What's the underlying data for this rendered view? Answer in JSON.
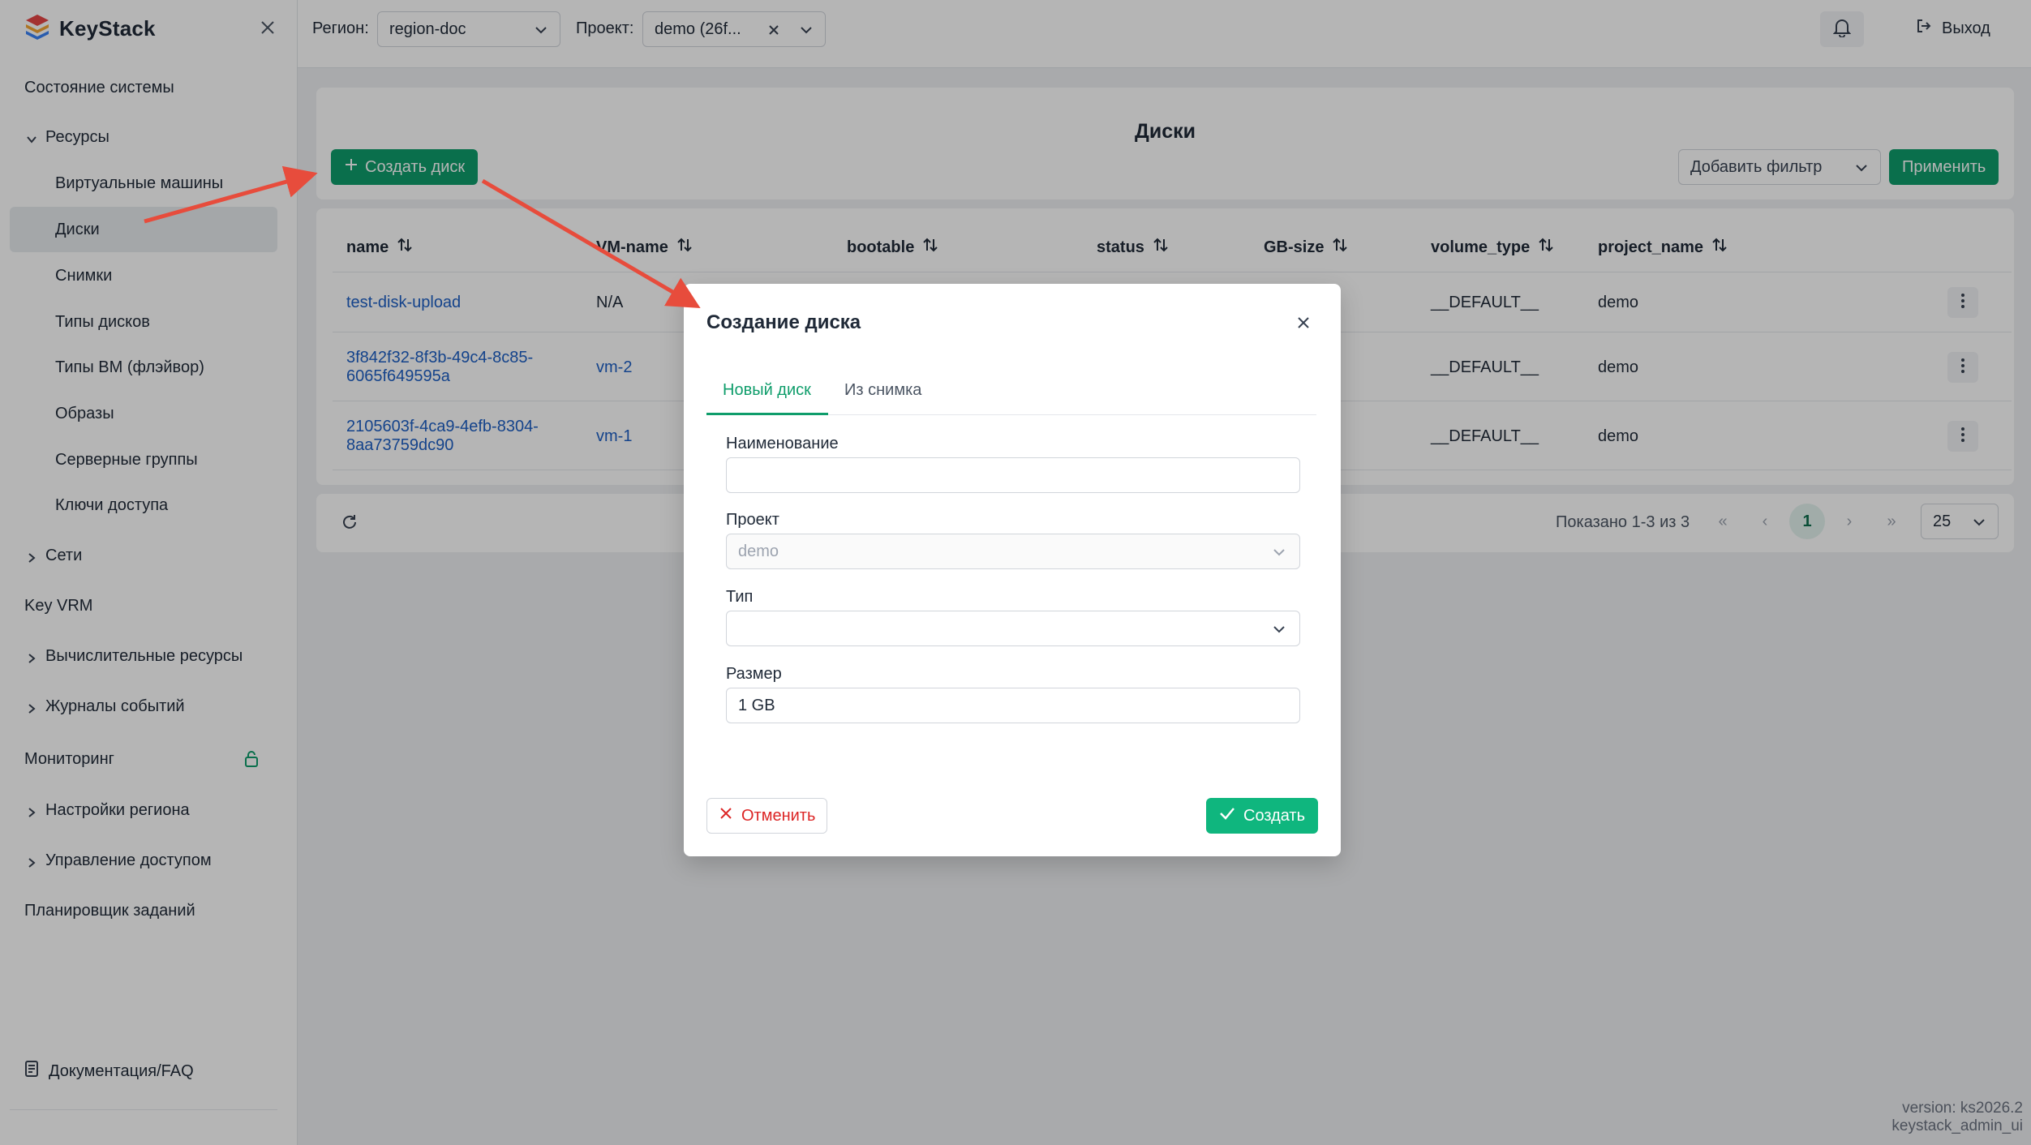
{
  "app": {
    "brand": "KeyStack"
  },
  "sidebar": {
    "items": [
      {
        "label": "Состояние системы"
      },
      {
        "label": "Ресурсы"
      },
      {
        "label": "Виртуальные машины"
      },
      {
        "label": "Диски"
      },
      {
        "label": "Снимки"
      },
      {
        "label": "Типы дисков"
      },
      {
        "label": "Типы ВМ (флэйвор)"
      },
      {
        "label": "Образы"
      },
      {
        "label": "Серверные группы"
      },
      {
        "label": "Ключи доступа"
      },
      {
        "label": "Сети"
      },
      {
        "label": "Key VRM"
      },
      {
        "label": "Вычислительные ресурсы"
      },
      {
        "label": "Журналы событий"
      },
      {
        "label": "Мониторинг"
      },
      {
        "label": "Настройки региона"
      },
      {
        "label": "Управление доступом"
      },
      {
        "label": "Планировщик заданий"
      }
    ],
    "footer": "Документация/FAQ"
  },
  "topbar": {
    "region_label": "Регион:",
    "region_value": "region-doc",
    "project_label": "Проект:",
    "project_value": "demo (26f...",
    "logout": "Выход"
  },
  "main": {
    "title": "Диски",
    "create_button": "Создать диск",
    "add_filter": "Добавить фильтр",
    "apply": "Применить",
    "columns": [
      "name",
      "VM-name",
      "bootable",
      "status",
      "GB-size",
      "volume_type",
      "project_name"
    ],
    "rows": [
      {
        "name_line1": "test-disk-upload",
        "name_line2": "",
        "vm": "N/A",
        "volume_type": "__DEFAULT__",
        "project": "demo"
      },
      {
        "name_line1": "3f842f32-8f3b-49c4-8c85-",
        "name_line2": "6065f649595a",
        "vm": "vm-2",
        "volume_type": "__DEFAULT__",
        "project": "demo"
      },
      {
        "name_line1": "2105603f-4ca9-4efb-8304-",
        "name_line2": "8aa73759dc90",
        "vm": "vm-1",
        "volume_type": "__DEFAULT__",
        "project": "demo"
      }
    ],
    "pager_text": "Показано 1-3 из 3",
    "current_page": "1",
    "per_page": "25"
  },
  "modal": {
    "title": "Создание диска",
    "tab_new": "Новый диск",
    "tab_snapshot": "Из снимка",
    "name_label": "Наименование",
    "name_value": "",
    "project_label": "Проект",
    "project_value": "demo",
    "type_label": "Тип",
    "type_value": "",
    "size_label": "Размер",
    "size_value": "1 GB",
    "cancel": "Отменить",
    "create": "Создать"
  },
  "version": {
    "line1": "version: ks2026.2",
    "line2": "keystack_admin_ui"
  },
  "colors": {
    "accent": "#0f9d6b",
    "link": "#1d5fc4",
    "annotation_arrow": "#e74c3c",
    "danger": "#dc2626"
  }
}
